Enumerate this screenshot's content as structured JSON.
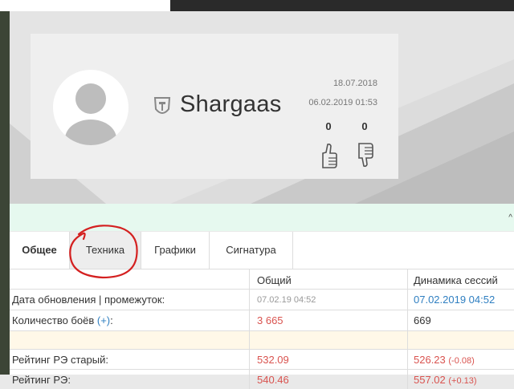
{
  "profile": {
    "username": "Shargaas",
    "date_registered": "18.07.2018",
    "date_last": "06.02.2019 01:53",
    "likes": "0",
    "dislikes": "0",
    "icons": {
      "avatar": "default-avatar-icon",
      "game": "tank-icon",
      "like": "thumbs-up-icon",
      "dislike": "thumbs-down-icon"
    }
  },
  "tabs": [
    {
      "label": "Общее",
      "active": true
    },
    {
      "label": "Техника",
      "active": false
    },
    {
      "label": "Графики",
      "active": false
    },
    {
      "label": "Сигнатура",
      "active": false
    }
  ],
  "notice": {
    "arrow": "^"
  },
  "table": {
    "columns": [
      "",
      "Общий",
      "Динамика сессий"
    ],
    "rows": [
      {
        "label": "Дата обновления | промежуток:",
        "total": "07.02.19 04:52",
        "session": "07.02.2019 04:52"
      },
      {
        "label": "Количество боёв",
        "label_link": "(+)",
        "label_suffix": ":",
        "total": "3 665",
        "session": "669"
      },
      {
        "label": "",
        "total": "",
        "session": ""
      },
      {
        "label": "Рейтинг РЭ старый:",
        "total": "532.09",
        "session": "526.23",
        "session_delta": "(-0.08)"
      },
      {
        "label": "Рейтинг РЭ:",
        "total": "540.46",
        "session": "557.02",
        "session_delta": "(+0.13)"
      }
    ]
  },
  "colors": {
    "accent_blue": "#2f7fc1",
    "red": "#d9534f",
    "annotation": "#d42020"
  }
}
